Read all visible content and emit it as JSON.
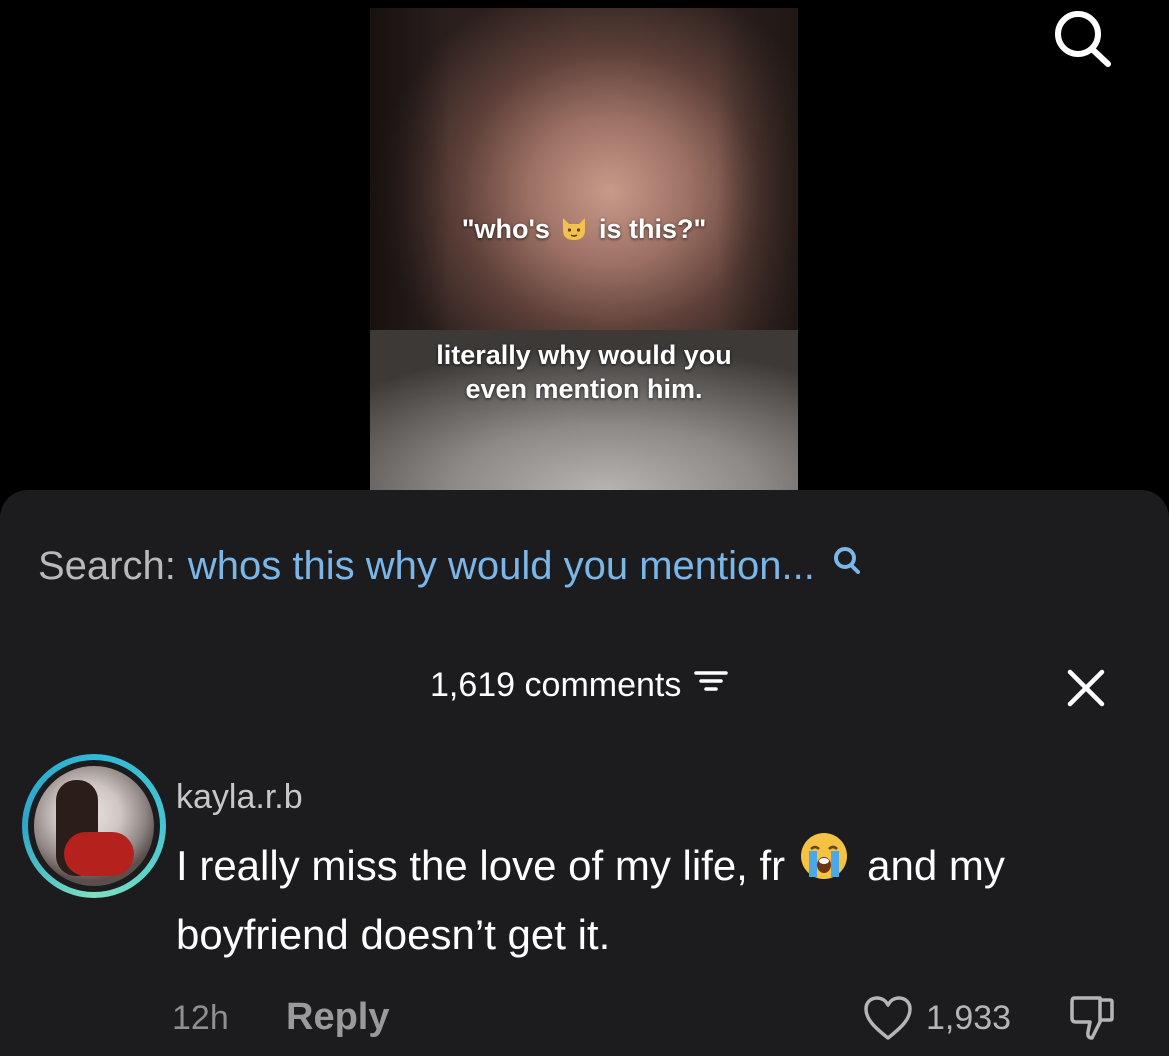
{
  "video": {
    "caption_line1_before": "\"who's",
    "caption_line1_after": "is this?\"",
    "caption_emoji": "cat-face-emoji",
    "caption_line2": "literally why would you",
    "caption_line3": "even mention him."
  },
  "header": {
    "search_icon": "search-icon"
  },
  "search": {
    "label": "Search:",
    "query": "whos this why would you mention...",
    "accent_color": "#7bb6e8"
  },
  "comments": {
    "count_label": "1,619 comments",
    "filter_icon": "filter-icon",
    "close_icon": "close-icon"
  },
  "comment": {
    "username": "kayla.r.b",
    "text_before": "I really miss the love of my life, fr",
    "emoji": "loudly-crying-face-emoji",
    "text_after": "and my boyfriend doesn’t get it.",
    "time": "12h",
    "reply_label": "Reply",
    "like_count": "1,933",
    "like_icon": "heart-icon",
    "dislike_icon": "thumbs-down-icon"
  }
}
